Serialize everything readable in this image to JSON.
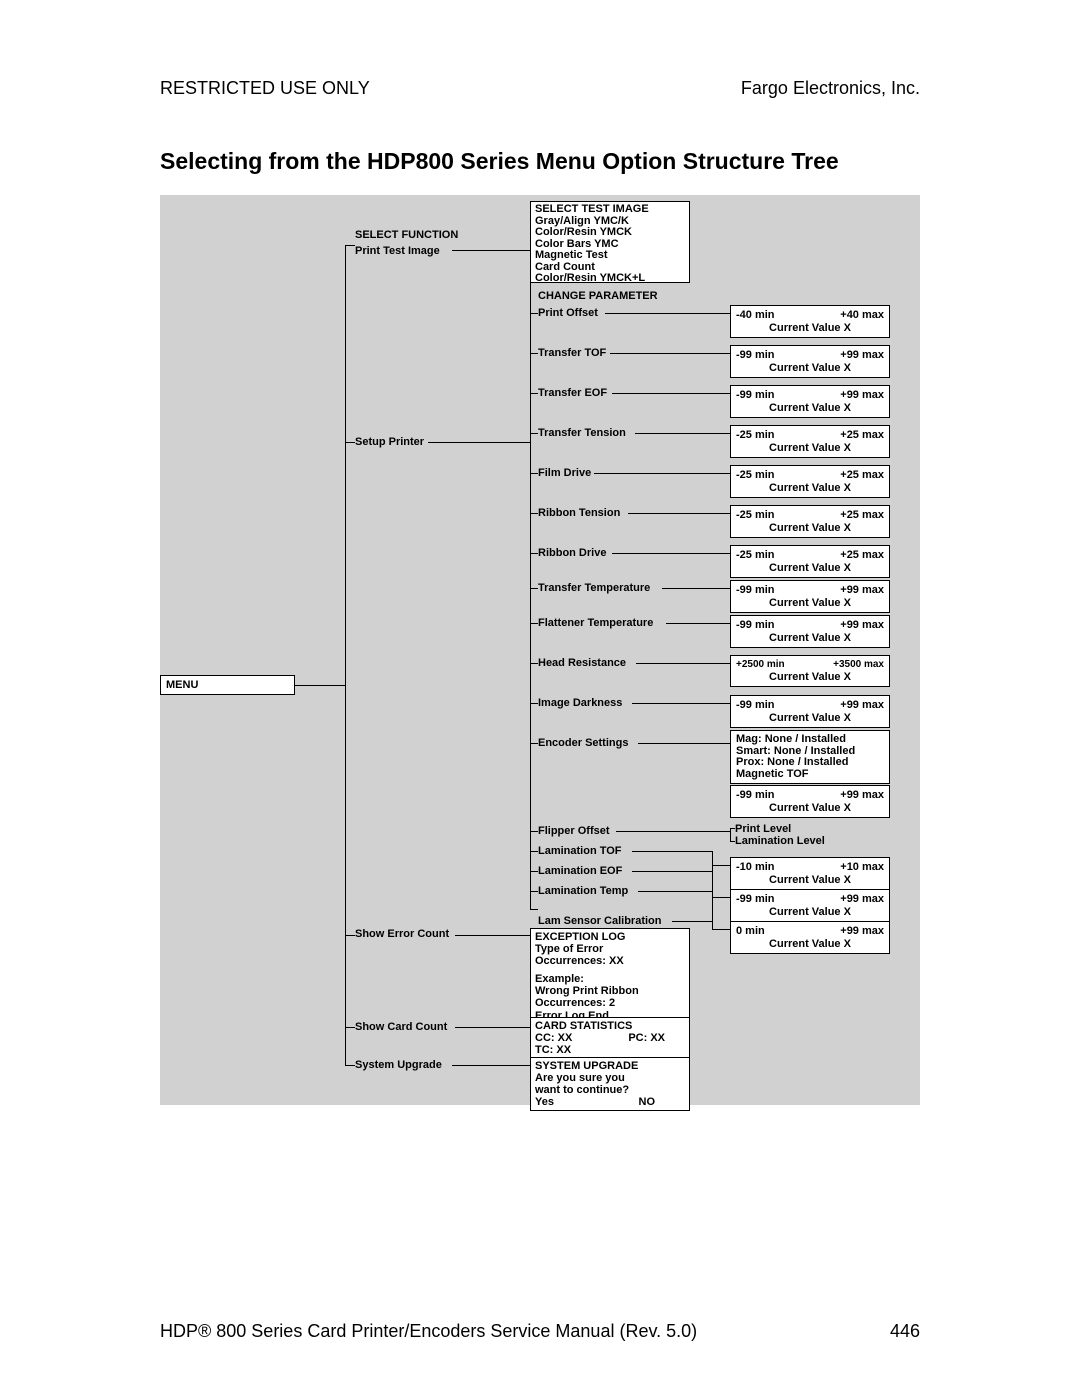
{
  "header": {
    "left": "RESTRICTED USE ONLY",
    "right": "Fargo Electronics, Inc."
  },
  "title": "Selecting from the HDP800 Series Menu Option Structure Tree",
  "footer": {
    "left": "HDP® 800 Series Card Printer/Encoders Service Manual (Rev. 5.0)",
    "right": "446"
  },
  "menu": "MENU",
  "col2": {
    "select_function": "SELECT FUNCTION",
    "print_test_image": "Print Test Image",
    "setup_printer": "Setup Printer",
    "show_error_count": "Show Error Count",
    "show_card_count": "Show Card Count",
    "system_upgrade": "System Upgrade"
  },
  "col3": {
    "sti_head": "SELECT TEST IMAGE",
    "sti_1": "Gray/Align YMC/K",
    "sti_2": "Color/Resin YMCK",
    "sti_3": "Color Bars YMC",
    "sti_4": "Magnetic Test",
    "sti_5": "Card Count",
    "sti_6": "Color/Resin YMCK+L",
    "change_param": "CHANGE PARAMETER",
    "print_offset": "Print Offset",
    "transfer_tof": "Transfer TOF",
    "transfer_eof": "Transfer EOF",
    "transfer_tension": "Transfer Tension",
    "film_drive": "Film Drive",
    "ribbon_tension": "Ribbon Tension",
    "ribbon_drive": "Ribbon Drive",
    "transfer_temp": "Transfer Temperature",
    "flat_temp": "Flattener Temperature",
    "head_res": "Head Resistance",
    "image_dark": "Image Darkness",
    "encoder_set": "Encoder Settings",
    "flipper_offset": "Flipper Offset",
    "lam_tof": "Lamination TOF",
    "lam_eof": "Lamination EOF",
    "lam_temp": "Lamination Temp",
    "lam_sensor": "Lam Sensor Calibration",
    "exc_head": "EXCEPTION LOG",
    "exc_l1": "Type of Error",
    "exc_l2": "Occurrences: XX",
    "exc_l3": "Example:",
    "exc_l4": "Wrong Print Ribbon",
    "exc_l5": "Occurrences: 2",
    "exc_l6": "Error Log End",
    "stat_head": "CARD STATISTICS",
    "stat_l1a": "CC: XX",
    "stat_l1b": "PC: XX",
    "stat_l2": "TC: XX",
    "upg_head": "SYSTEM UPGRADE",
    "upg_l1": "Are you sure you",
    "upg_l2": "want to continue?",
    "upg_yes": "Yes",
    "upg_no": "NO"
  },
  "col4": {
    "curval": "Current Value X",
    "r_40": {
      "min": "-40 min",
      "max": "+40 max"
    },
    "r_99": {
      "min": "-99 min",
      "max": "+99 max"
    },
    "r_25": {
      "min": "-25 min",
      "max": "+25 max"
    },
    "r_head": {
      "min": "+2500 min",
      "max": "+3500 max"
    },
    "print_level": "Print Level",
    "lam_level": "Lamination Level",
    "r_10": {
      "min": "-10 min",
      "max": "+10 max"
    },
    "r_0_99": {
      "min": "0 min",
      "max": "+99 max"
    },
    "enc_1": "Mag: None / Installed",
    "enc_2": "Smart: None / Installed",
    "enc_3": "Prox: None / Installed",
    "enc_4": "Magnetic TOF"
  }
}
